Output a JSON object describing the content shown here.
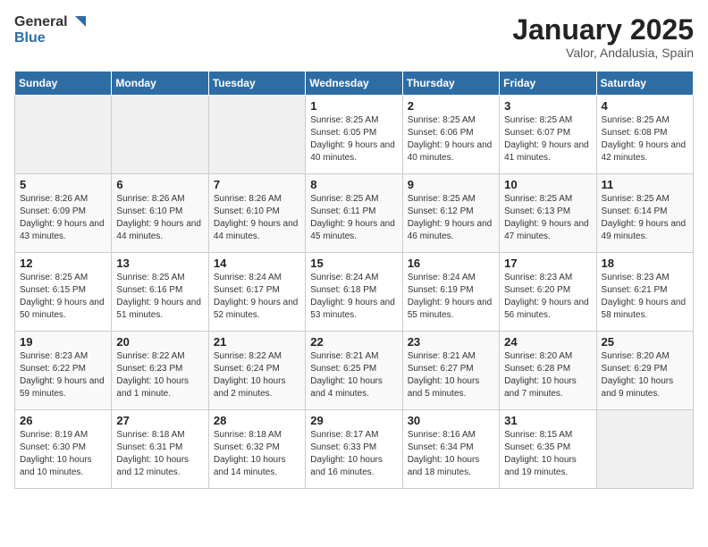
{
  "logo": {
    "general": "General",
    "blue": "Blue"
  },
  "title": "January 2025",
  "subtitle": "Valor, Andalusia, Spain",
  "days_of_week": [
    "Sunday",
    "Monday",
    "Tuesday",
    "Wednesday",
    "Thursday",
    "Friday",
    "Saturday"
  ],
  "weeks": [
    [
      {
        "num": "",
        "empty": true
      },
      {
        "num": "",
        "empty": true
      },
      {
        "num": "",
        "empty": true
      },
      {
        "num": "1",
        "sunrise": "8:25 AM",
        "sunset": "6:05 PM",
        "daylight": "9 hours and 40 minutes."
      },
      {
        "num": "2",
        "sunrise": "8:25 AM",
        "sunset": "6:06 PM",
        "daylight": "9 hours and 40 minutes."
      },
      {
        "num": "3",
        "sunrise": "8:25 AM",
        "sunset": "6:07 PM",
        "daylight": "9 hours and 41 minutes."
      },
      {
        "num": "4",
        "sunrise": "8:25 AM",
        "sunset": "6:08 PM",
        "daylight": "9 hours and 42 minutes."
      }
    ],
    [
      {
        "num": "5",
        "sunrise": "8:26 AM",
        "sunset": "6:09 PM",
        "daylight": "9 hours and 43 minutes."
      },
      {
        "num": "6",
        "sunrise": "8:26 AM",
        "sunset": "6:10 PM",
        "daylight": "9 hours and 44 minutes."
      },
      {
        "num": "7",
        "sunrise": "8:26 AM",
        "sunset": "6:10 PM",
        "daylight": "9 hours and 44 minutes."
      },
      {
        "num": "8",
        "sunrise": "8:25 AM",
        "sunset": "6:11 PM",
        "daylight": "9 hours and 45 minutes."
      },
      {
        "num": "9",
        "sunrise": "8:25 AM",
        "sunset": "6:12 PM",
        "daylight": "9 hours and 46 minutes."
      },
      {
        "num": "10",
        "sunrise": "8:25 AM",
        "sunset": "6:13 PM",
        "daylight": "9 hours and 47 minutes."
      },
      {
        "num": "11",
        "sunrise": "8:25 AM",
        "sunset": "6:14 PM",
        "daylight": "9 hours and 49 minutes."
      }
    ],
    [
      {
        "num": "12",
        "sunrise": "8:25 AM",
        "sunset": "6:15 PM",
        "daylight": "9 hours and 50 minutes."
      },
      {
        "num": "13",
        "sunrise": "8:25 AM",
        "sunset": "6:16 PM",
        "daylight": "9 hours and 51 minutes."
      },
      {
        "num": "14",
        "sunrise": "8:24 AM",
        "sunset": "6:17 PM",
        "daylight": "9 hours and 52 minutes."
      },
      {
        "num": "15",
        "sunrise": "8:24 AM",
        "sunset": "6:18 PM",
        "daylight": "9 hours and 53 minutes."
      },
      {
        "num": "16",
        "sunrise": "8:24 AM",
        "sunset": "6:19 PM",
        "daylight": "9 hours and 55 minutes."
      },
      {
        "num": "17",
        "sunrise": "8:23 AM",
        "sunset": "6:20 PM",
        "daylight": "9 hours and 56 minutes."
      },
      {
        "num": "18",
        "sunrise": "8:23 AM",
        "sunset": "6:21 PM",
        "daylight": "9 hours and 58 minutes."
      }
    ],
    [
      {
        "num": "19",
        "sunrise": "8:23 AM",
        "sunset": "6:22 PM",
        "daylight": "9 hours and 59 minutes."
      },
      {
        "num": "20",
        "sunrise": "8:22 AM",
        "sunset": "6:23 PM",
        "daylight": "10 hours and 1 minute."
      },
      {
        "num": "21",
        "sunrise": "8:22 AM",
        "sunset": "6:24 PM",
        "daylight": "10 hours and 2 minutes."
      },
      {
        "num": "22",
        "sunrise": "8:21 AM",
        "sunset": "6:25 PM",
        "daylight": "10 hours and 4 minutes."
      },
      {
        "num": "23",
        "sunrise": "8:21 AM",
        "sunset": "6:27 PM",
        "daylight": "10 hours and 5 minutes."
      },
      {
        "num": "24",
        "sunrise": "8:20 AM",
        "sunset": "6:28 PM",
        "daylight": "10 hours and 7 minutes."
      },
      {
        "num": "25",
        "sunrise": "8:20 AM",
        "sunset": "6:29 PM",
        "daylight": "10 hours and 9 minutes."
      }
    ],
    [
      {
        "num": "26",
        "sunrise": "8:19 AM",
        "sunset": "6:30 PM",
        "daylight": "10 hours and 10 minutes."
      },
      {
        "num": "27",
        "sunrise": "8:18 AM",
        "sunset": "6:31 PM",
        "daylight": "10 hours and 12 minutes."
      },
      {
        "num": "28",
        "sunrise": "8:18 AM",
        "sunset": "6:32 PM",
        "daylight": "10 hours and 14 minutes."
      },
      {
        "num": "29",
        "sunrise": "8:17 AM",
        "sunset": "6:33 PM",
        "daylight": "10 hours and 16 minutes."
      },
      {
        "num": "30",
        "sunrise": "8:16 AM",
        "sunset": "6:34 PM",
        "daylight": "10 hours and 18 minutes."
      },
      {
        "num": "31",
        "sunrise": "8:15 AM",
        "sunset": "6:35 PM",
        "daylight": "10 hours and 19 minutes."
      },
      {
        "num": "",
        "empty": true
      }
    ]
  ],
  "labels": {
    "sunrise": "Sunrise:",
    "sunset": "Sunset:",
    "daylight": "Daylight hours"
  }
}
